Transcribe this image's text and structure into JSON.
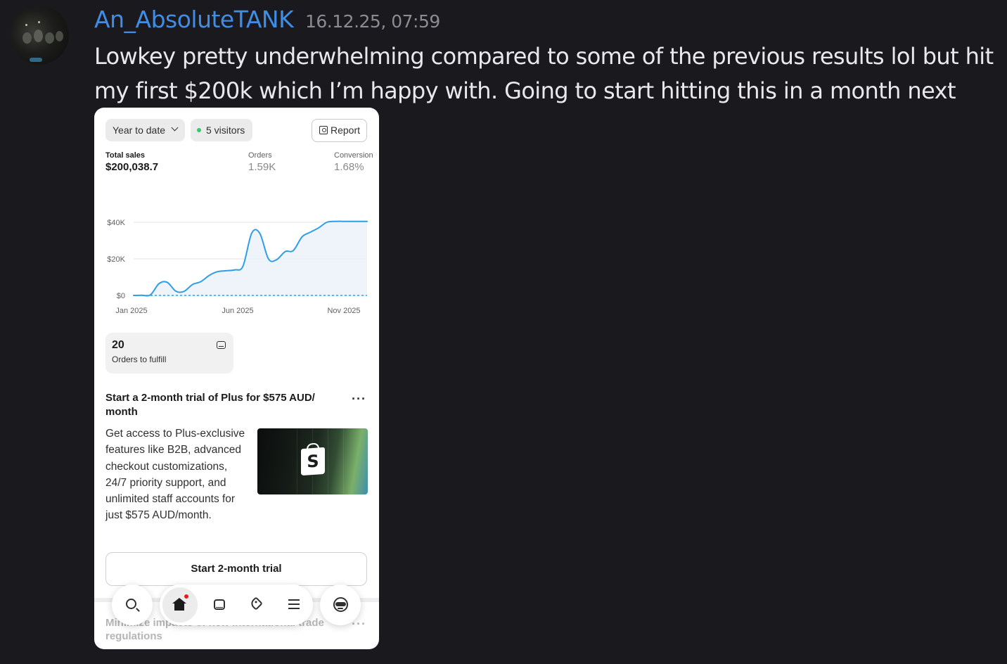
{
  "post": {
    "username": "An_AbsoluteTANK",
    "timestamp": "16.12.25, 07:59",
    "message": "Lowkey pretty underwhelming compared to some of the previous results lol but hit my first $200k which I’m happy with. Going to start hitting this in a month next year."
  },
  "dashboard": {
    "date_filter": "Year to date",
    "visitors": "5 visitors",
    "report_label": "Report",
    "metrics": {
      "total_sales": {
        "label": "Total sales",
        "value": "$200,038.7"
      },
      "orders": {
        "label": "Orders",
        "value": "1.59K"
      },
      "conversion": {
        "label": "Conversion",
        "value": "1.68%"
      }
    },
    "orders_to_fulfill": {
      "count": "20",
      "label": "Orders to fulfill"
    },
    "promo": {
      "title": "Start a 2-month trial of Plus for $575 AUD/ month",
      "body": "Get access to Plus-exclusive features like B2B, advanced checkout customizations, 24/7 priority support, and unlimited staff accounts for just $575 AUD/month.",
      "cta": "Start 2-month trial",
      "more": "···"
    },
    "next_card": {
      "title": "Minimize impacts of new international trade regulations",
      "more": "···"
    },
    "nav": [
      "search-icon",
      "home-icon",
      "inbox-icon",
      "tag-icon",
      "menu-icon",
      "sidekick-icon"
    ]
  },
  "chart_data": {
    "type": "line",
    "x_tick_labels": [
      "Jan 2025",
      "Jun 2025",
      "Nov 2025"
    ],
    "y_tick_labels": [
      "$0",
      "$20K",
      "$40K"
    ],
    "ylim": [
      0,
      40000
    ],
    "series": [
      {
        "x": [
          "2025-01-01",
          "2025-01-13",
          "2025-01-26",
          "2025-02-08",
          "2025-02-20",
          "2025-03-05",
          "2025-03-17",
          "2025-03-30",
          "2025-04-11",
          "2025-04-24",
          "2025-05-06",
          "2025-05-19",
          "2025-06-01",
          "2025-06-13",
          "2025-06-26",
          "2025-07-08",
          "2025-07-21",
          "2025-08-02",
          "2025-08-15",
          "2025-08-27",
          "2025-09-09",
          "2025-09-21",
          "2025-10-04",
          "2025-10-16",
          "2025-10-29",
          "2025-11-10",
          "2025-11-22",
          "2025-12-05",
          "2025-12-15"
        ],
        "values": [
          0,
          100,
          300,
          6500,
          7200,
          2300,
          2200,
          6000,
          7500,
          11000,
          13000,
          13500,
          14000,
          16000,
          34000,
          34000,
          20000,
          19500,
          24000,
          24500,
          32000,
          34500,
          37000,
          40000,
          40500,
          40500,
          40500,
          40500,
          40500
        ]
      },
      {
        "x": [
          "2025-01-01",
          "2025-12-15"
        ],
        "values": [
          0,
          0
        ],
        "style": "dashed"
      }
    ],
    "grid": true
  },
  "colors": {
    "background": "#1a1a1e",
    "username": "#3f8de4",
    "line": "#2e9ee8",
    "area_fill": "#eaf1f8"
  }
}
